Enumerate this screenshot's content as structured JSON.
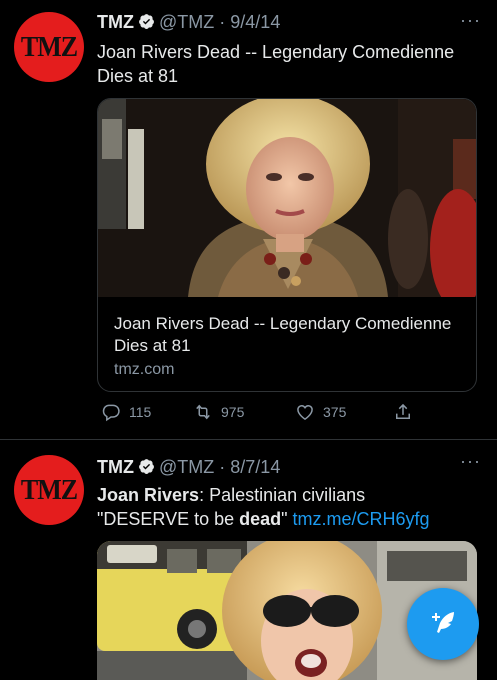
{
  "tweets": [
    {
      "avatar_logo": "TMZ",
      "name": "TMZ",
      "handle": "@TMZ",
      "dot": "·",
      "date": "9/4/14",
      "more": "···",
      "text": "Joan Rivers Dead -- Legendary Comedienne Dies at 81",
      "card": {
        "image_icon": "photo-joan-rivers",
        "title": "Joan Rivers Dead -- Legendary Comedienne Dies at 81",
        "domain": "tmz.com"
      },
      "actions": {
        "replies": "115",
        "retweets": "975",
        "likes": "375"
      }
    },
    {
      "avatar_logo": "TMZ",
      "name": "TMZ",
      "handle": "@TMZ",
      "dot": "·",
      "date": "8/7/14",
      "more": "···",
      "text_bold": "Joan Rivers",
      "text_rest": ": Palestinian civilians",
      "text_line2_quote": "\"DESERVE to be ",
      "text_line2_bold": "dead",
      "text_line2_end": "\" ",
      "link": "tmz.me/CRH6yfg",
      "media_icon": "photo-joan-rivers-sunglasses"
    }
  ],
  "fab": {
    "icon": "compose-tweet-icon"
  },
  "colors": {
    "accent": "#1d9bf0",
    "avatar": "#e41d1d",
    "secondary_text": "#8b98a5"
  }
}
